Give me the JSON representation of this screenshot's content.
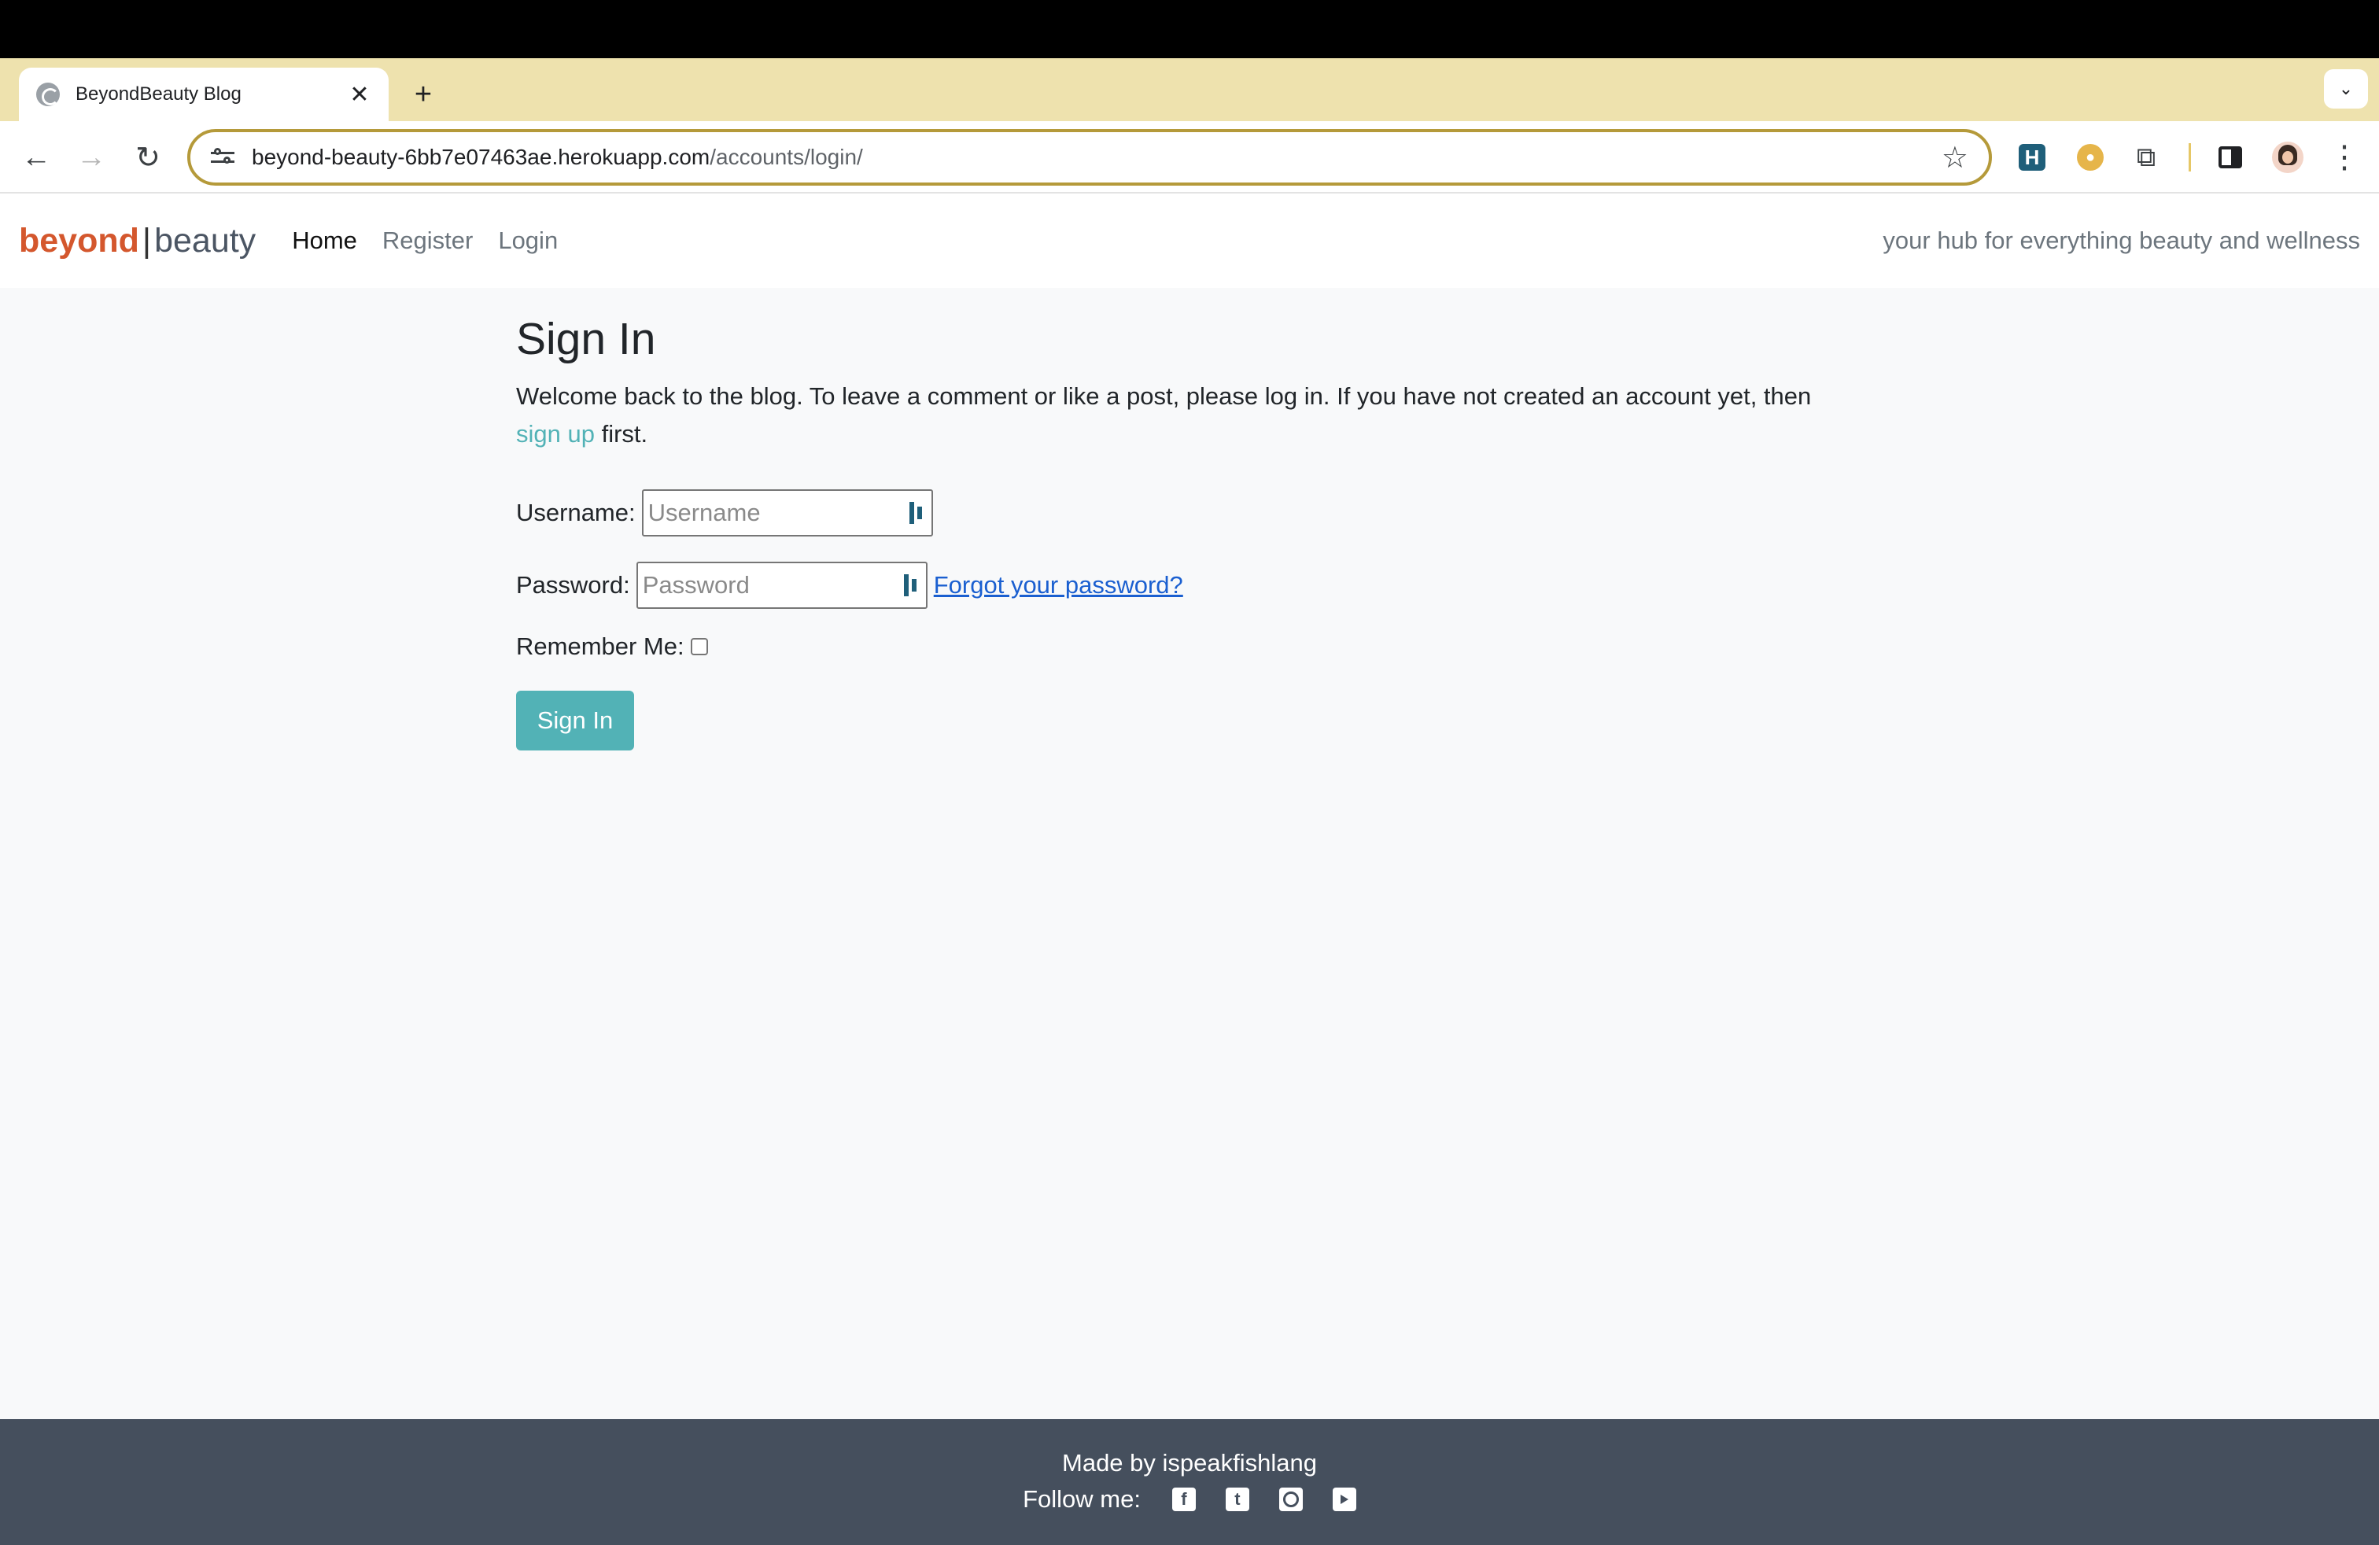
{
  "browser": {
    "tab_title": "BeyondBeauty Blog",
    "tab_close": "✕",
    "new_tab": "+",
    "url_host": "beyond-beauty-6bb7e07463ae.herokuapp.com",
    "url_path": "/accounts/login/",
    "ext_h_label": "H"
  },
  "site": {
    "brand_left": "beyond",
    "brand_sep": "|",
    "brand_right": "beauty",
    "nav": [
      {
        "label": "Home",
        "active": true
      },
      {
        "label": "Register"
      },
      {
        "label": "Login"
      }
    ],
    "tagline": "your hub for everything beauty and wellness"
  },
  "login": {
    "title": "Sign In",
    "intro_before": "Welcome back to the blog. To leave a comment or like a post, please log in. If you have not created an account yet, then ",
    "intro_link": "sign up",
    "intro_after": " first.",
    "username_label": "Username:",
    "username_placeholder": "Username",
    "password_label": "Password:",
    "password_placeholder": "Password",
    "forgot_link": "Forgot your password?",
    "remember_label": "Remember Me:",
    "remember_checked": false,
    "submit": "Sign In"
  },
  "footer": {
    "made_by": "Made by ispeakfishlang",
    "follow": "Follow me:",
    "social_icons": [
      "facebook-icon",
      "twitter-icon",
      "instagram-icon",
      "youtube-icon"
    ]
  },
  "colors": {
    "brand_accent": "#d4572d",
    "teal": "#52b2b6",
    "footer_bg": "#454f5d",
    "tabstrip_bg": "#eee2ae"
  }
}
